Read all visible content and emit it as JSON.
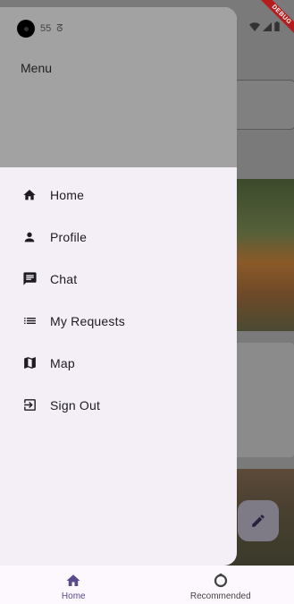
{
  "status_bar": {
    "time": "55"
  },
  "debug_banner": "DEBUG",
  "drawer": {
    "title": "Menu",
    "items": [
      {
        "label": "Home",
        "icon": "home-icon"
      },
      {
        "label": "Profile",
        "icon": "person-icon"
      },
      {
        "label": "Chat",
        "icon": "chat-icon"
      },
      {
        "label": "My Requests",
        "icon": "list-icon"
      },
      {
        "label": "Map",
        "icon": "map-icon"
      },
      {
        "label": "Sign Out",
        "icon": "logout-icon"
      }
    ]
  },
  "bottom_nav": {
    "items": [
      {
        "label": "Home",
        "icon": "home-icon",
        "active": true
      },
      {
        "label": "Recommended",
        "icon": "recommended-icon",
        "active": false
      }
    ]
  },
  "colors": {
    "accent": "#5a4a8c",
    "drawer_bg": "#f4eff7",
    "header_bg": "#a2a2a2"
  }
}
